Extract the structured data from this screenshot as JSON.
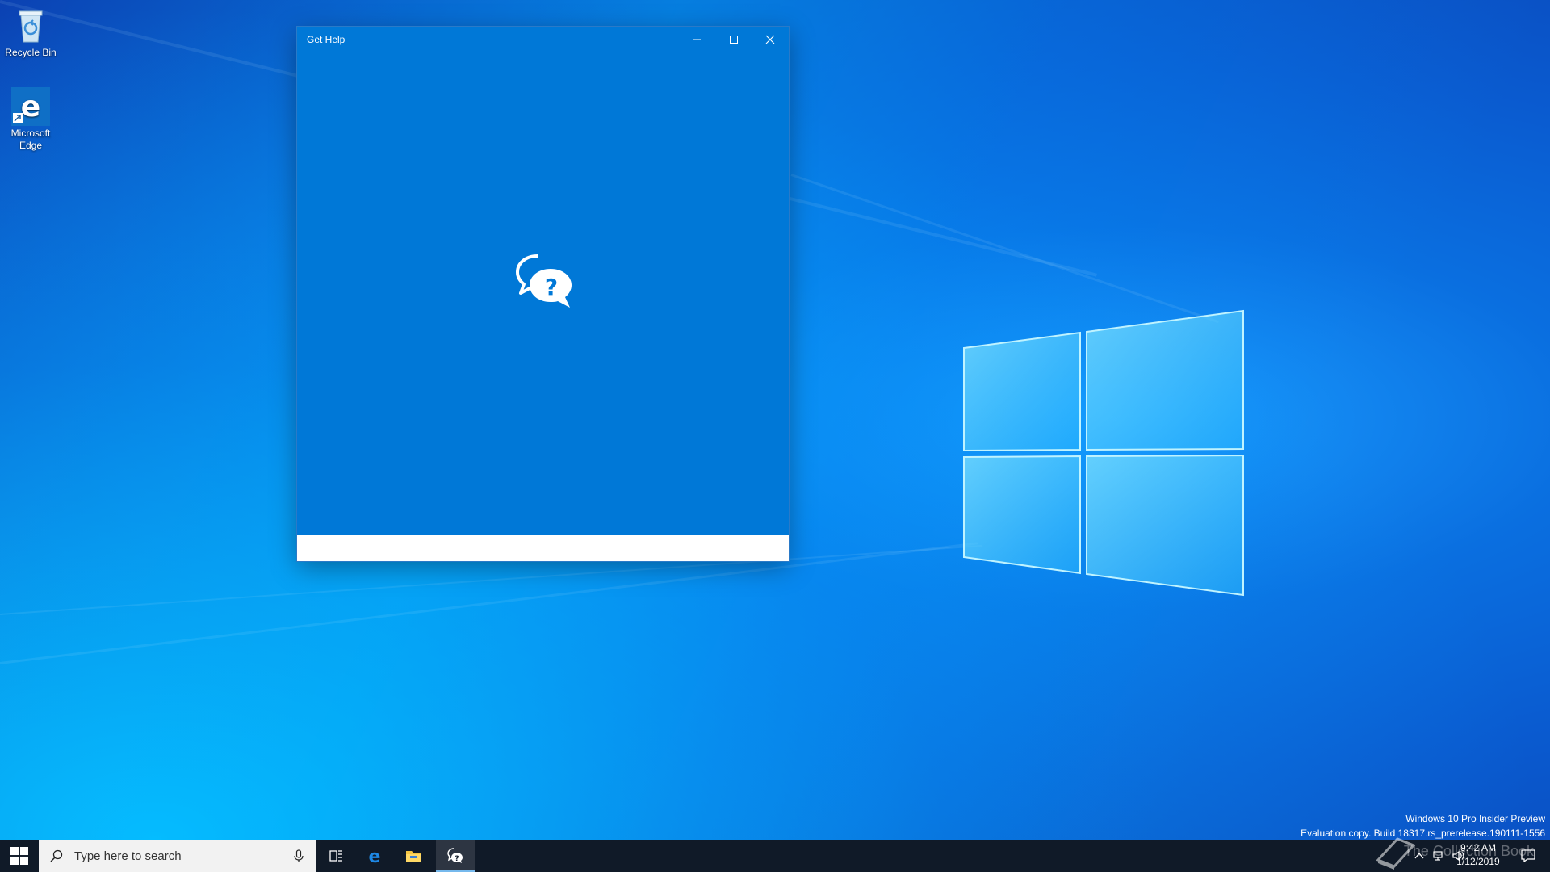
{
  "desktop": {
    "icons": [
      {
        "label": "Recycle Bin"
      },
      {
        "label": "Microsoft Edge"
      }
    ]
  },
  "window": {
    "title": "Get Help",
    "app_icon": "help-chat-icon",
    "controls": [
      "minimize-icon",
      "maximize-icon",
      "close-icon"
    ]
  },
  "watermark": {
    "line1": "Windows 10 Pro Insider Preview",
    "line2": "Evaluation copy. Build 18317.rs_prerelease.190111-1556"
  },
  "taskbar": {
    "search_placeholder": "Type here to search",
    "pinned": [
      "task-view-icon",
      "edge-icon",
      "file-explorer-icon",
      "get-help-icon"
    ],
    "time": "9:42 AM",
    "date": "1/12/2019",
    "overlay_text": "The Collection Book"
  },
  "colors": {
    "window_bg": "#0078d7",
    "taskbar_bg": "#101a28",
    "search_bg": "#f2f2f2"
  }
}
